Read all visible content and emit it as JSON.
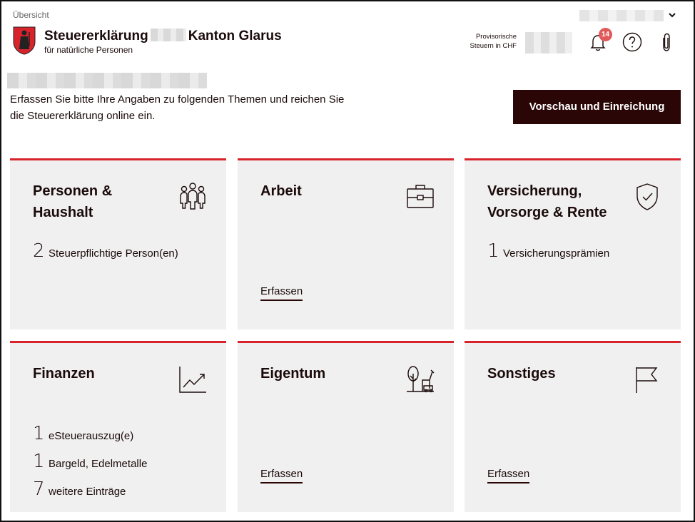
{
  "header": {
    "breadcrumb": "Übersicht",
    "title_left": "Steuererklärung",
    "title_right": "Kanton Glarus",
    "subtitle": "für natürliche Personen",
    "provisional_label": "Provisorische Steuern in CHF",
    "notification_count": "14",
    "cta_label": "Vorschau und Einreichung"
  },
  "intro": "Erfassen Sie bitte Ihre Angaben zu folgenden Themen und reichen Sie die Steuererklärung online ein.",
  "cards": [
    {
      "title": "Personen & Haushalt",
      "icon": "people-icon",
      "items": [
        {
          "count": "2",
          "label": "Steuerpflichtige Person(en)"
        }
      ]
    },
    {
      "title": "Arbeit",
      "icon": "briefcase-icon",
      "action": "Erfassen"
    },
    {
      "title": "Versicherung, Vorsorge & Rente",
      "icon": "shield-check-icon",
      "items": [
        {
          "count": "1",
          "label": "Versicherungsprämien"
        }
      ]
    },
    {
      "title": "Finanzen",
      "icon": "chart-icon",
      "items": [
        {
          "count": "1",
          "label": "eSteuerauszug(e)"
        },
        {
          "count": "1",
          "label": "Bargeld, Edelmetalle"
        },
        {
          "count": "7",
          "label": "weitere Einträge"
        }
      ]
    },
    {
      "title": "Eigentum",
      "icon": "property-icon",
      "action": "Erfassen"
    },
    {
      "title": "Sonstiges",
      "icon": "flag-icon",
      "action": "Erfassen"
    }
  ],
  "colors": {
    "accent": "#d9232c",
    "dark": "#2a0606",
    "card_bg": "#f1f0f0"
  }
}
